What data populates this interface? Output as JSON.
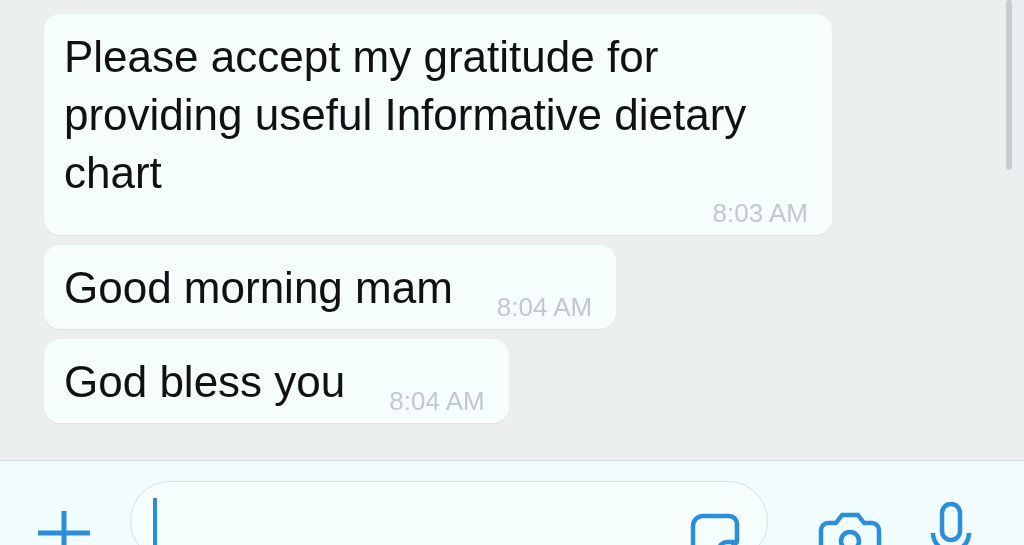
{
  "messages": [
    {
      "text": "Please accept my gratitude for providing useful Informative dietary chart",
      "time": "8:03 AM"
    },
    {
      "text": "Good morning mam",
      "time": "8:04 AM"
    },
    {
      "text": "God bless you",
      "time": "8:04 AM"
    }
  ],
  "composer": {
    "cursor": true
  }
}
